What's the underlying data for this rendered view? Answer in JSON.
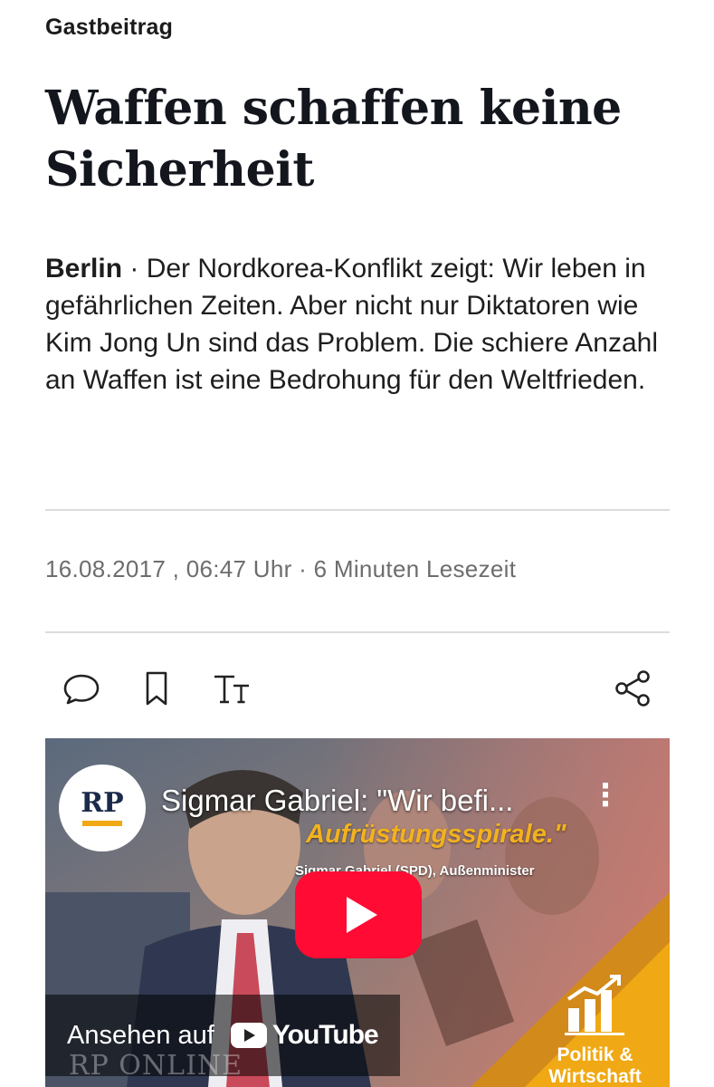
{
  "article": {
    "kicker": "Gastbeitrag",
    "headline": "Waffen schaffen keine Sicherheit",
    "location": "Berlin",
    "teaser_separator": " · ",
    "teaser": "Der Nordkorea-Konflikt zeigt: Wir leben in gefährlichen Zeiten. Aber nicht nur Diktatoren wie Kim Jong Un sind das Problem. Die schiere Anzahl an Waffen ist eine Bedrohung für den Weltfrieden.",
    "meta": "16.08.2017 , 06:47 Uhr · 6 Minuten Lesezeit"
  },
  "toolbar": {
    "icons": [
      "comment-icon",
      "bookmark-icon",
      "text-size-icon",
      "share-icon"
    ],
    "text_size_glyph": "TT"
  },
  "video": {
    "channel_logo_text": "RP",
    "title": "Sigmar Gabriel: \"Wir befi...",
    "more_glyph": "⋮",
    "overlay_quote": "Aufrüstungsspirale.\"",
    "overlay_sub": "Sigmar Gabriel (SPD), Außenminister",
    "watch_label": "Ansehen auf",
    "youtube_word": "YouTube",
    "watermark": "RP ONLINE",
    "category_label": "Politik & Wirtschaft"
  },
  "colors": {
    "accent_orange": "#f0a814",
    "play_red": "#ff0b33",
    "headline": "#13161d",
    "meta_gray": "#6d6d6d",
    "divider": "#dcdcdc"
  }
}
